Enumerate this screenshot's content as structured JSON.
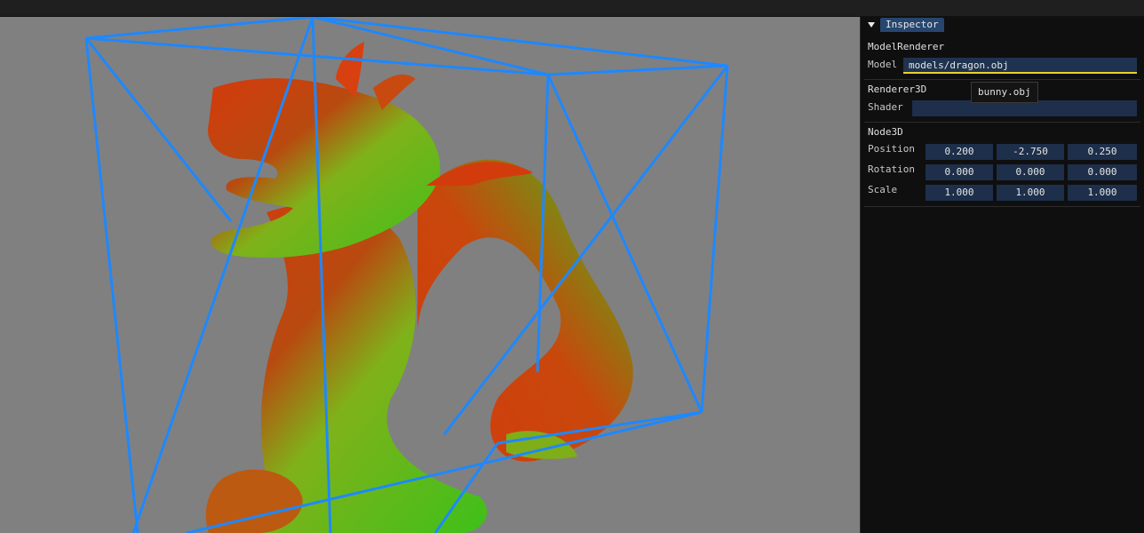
{
  "viewport": {
    "bbox_color": "#1e88ff",
    "model_colors": [
      "#d43a0c",
      "#3ec01a"
    ]
  },
  "inspector": {
    "title": "Inspector",
    "model_renderer": {
      "title": "ModelRenderer",
      "model_label": "Model",
      "model_value": "models/dragon.obj",
      "suggestion": "bunny.obj"
    },
    "renderer3d": {
      "title": "Renderer3D",
      "shader_label": "Shader",
      "shader_value": ""
    },
    "node3d": {
      "title": "Node3D",
      "position_label": "Position",
      "position": [
        "0.200",
        "-2.750",
        "0.250"
      ],
      "rotation_label": "Rotation",
      "rotation": [
        "0.000",
        "0.000",
        "0.000"
      ],
      "scale_label": "Scale",
      "scale": [
        "1.000",
        "1.000",
        "1.000"
      ]
    }
  }
}
